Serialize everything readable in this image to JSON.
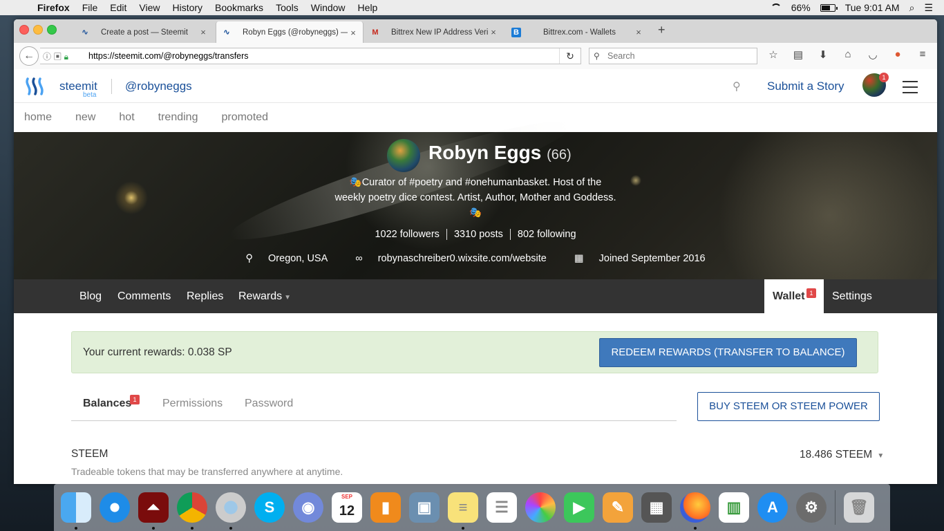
{
  "menubar": {
    "app": "Firefox",
    "items": [
      "File",
      "Edit",
      "View",
      "History",
      "Bookmarks",
      "Tools",
      "Window",
      "Help"
    ],
    "battery": "66%",
    "clock": "Tue 9:01 AM"
  },
  "browser": {
    "tabs": [
      {
        "title": "Create a post — Steemit",
        "icon": "steemit-icon"
      },
      {
        "title": "Robyn Eggs (@robyneggs) —",
        "icon": "steemit-icon"
      },
      {
        "title": "Bittrex New IP Address Verific",
        "icon": "gmail-icon"
      },
      {
        "title": "Bittrex.com - Wallets",
        "icon": "bittrex-icon"
      }
    ],
    "url": "https://steemit.com/@robyneggs/transfers",
    "search_placeholder": "Search"
  },
  "site": {
    "brand": "steemit",
    "beta": "beta",
    "username": "@robyneggs",
    "submit": "Submit a Story",
    "avatar_badge": "1",
    "nav": [
      "home",
      "new",
      "hot",
      "trending",
      "promoted"
    ]
  },
  "profile": {
    "name": "Robyn Eggs",
    "reputation": "(66)",
    "bio_line1": "🎭Curator of #poetry and #onehumanbasket. Host of the",
    "bio_line2": "weekly poetry dice contest. Artist, Author, Mother and Goddess.",
    "bio_line3": "🎭",
    "followers": "1022 followers",
    "posts": "3310 posts",
    "following": "802 following",
    "location": "Oregon, USA",
    "website": "robynaschreiber0.wixsite.com/website",
    "joined": "Joined September 2016"
  },
  "profile_tabs": {
    "blog": "Blog",
    "comments": "Comments",
    "replies": "Replies",
    "rewards": "Rewards",
    "wallet": "Wallet",
    "wallet_badge": "1",
    "settings": "Settings"
  },
  "wallet": {
    "rewards_text": "Your current rewards: 0.038 SP",
    "redeem_button": "REDEEM REWARDS (TRANSFER TO BALANCE)",
    "tabs": {
      "balances": "Balances",
      "balances_badge": "1",
      "permissions": "Permissions",
      "password": "Password"
    },
    "buy_button": "BUY STEEM OR STEEM POWER",
    "steem_label": "STEEM",
    "steem_desc": "Tradeable tokens that may be transferred anywhere at anytime.",
    "steem_value": "18.486 STEEM"
  },
  "dock": {
    "apps": [
      "Finder",
      "Safari",
      "Acrobat",
      "Chrome",
      "Preview",
      "Skype",
      "Discord",
      "Calendar",
      "iBooks",
      "Image Capture",
      "Notes",
      "Reminders",
      "Photos",
      "FaceTime",
      "Pages",
      "Calculator",
      "Firefox",
      "Numbers",
      "App Store",
      "System Preferences",
      "Trash"
    ],
    "calendar_month": "SEP",
    "calendar_day": "12"
  }
}
